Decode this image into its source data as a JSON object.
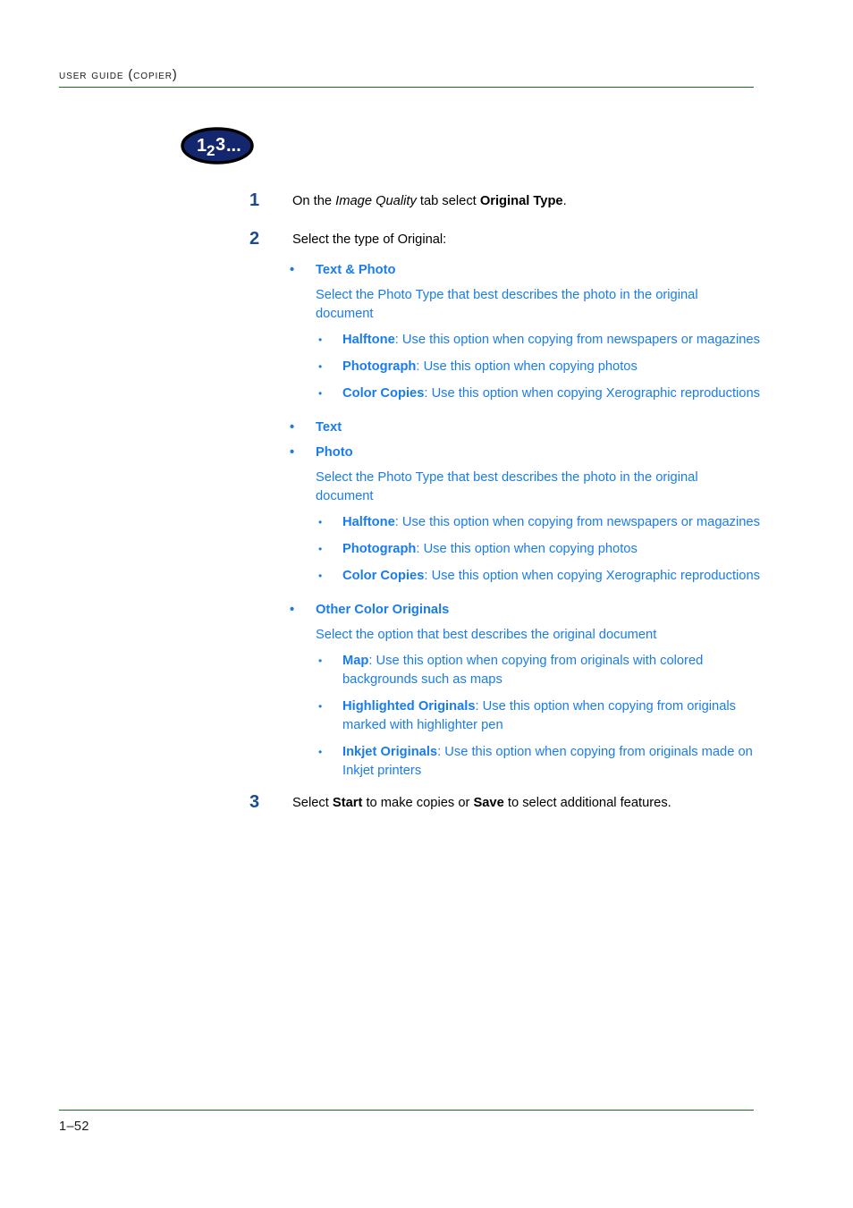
{
  "header": {
    "running_title": "User Guide (Copier)"
  },
  "badge": {
    "name": "numbered-steps-badge",
    "text": "123...",
    "fill_color": "#13266e",
    "stroke_color": "#000000",
    "text_color": "#ffffff",
    "parts": {
      "one": "1",
      "two": "2",
      "three": "3",
      "ellipsis": "..."
    }
  },
  "colors": {
    "rule_green": "#176b17",
    "step_number_blue": "#1b4a91",
    "option_blue": "#1a7ceb",
    "body_black": "#000000"
  },
  "steps": [
    {
      "number": "1",
      "text_before": "On the ",
      "italic": "Image Quality",
      "text_mid": " tab select ",
      "bold": "Original Type",
      "text_after": "."
    },
    {
      "number": "2",
      "text": "Select the type of Original:"
    },
    {
      "number": "3",
      "text_before": "Select ",
      "bold1": "Start",
      "text_mid": " to make copies or ",
      "bold2": "Save",
      "text_after": " to select additional features."
    }
  ],
  "options": [
    {
      "bullet": "•",
      "title": "Text & Photo",
      "description": "Select the Photo Type that best describes the photo in the original document",
      "subitems": [
        {
          "bullet": "•",
          "term": "Halftone",
          "desc": ": Use this option when copying from newspapers or magazines"
        },
        {
          "bullet": "•",
          "term": "Photograph",
          "desc": ": Use this option when copying photos"
        },
        {
          "bullet": "•",
          "term": "Color Copies",
          "desc": ": Use this option when copying Xerographic reproductions"
        }
      ]
    },
    {
      "bullet": "•",
      "title": "Text",
      "description": "",
      "subitems": []
    },
    {
      "bullet": "•",
      "title": "Photo",
      "description": "Select the Photo Type that best describes the photo in the original document",
      "subitems": [
        {
          "bullet": "•",
          "term": "Halftone",
          "desc": ": Use this option when copying from newspapers or magazines"
        },
        {
          "bullet": "•",
          "term": "Photograph",
          "desc": ": Use this option when copying photos"
        },
        {
          "bullet": "•",
          "term": "Color Copies",
          "desc": ": Use this option when copying Xerographic reproductions"
        }
      ]
    },
    {
      "bullet": "•",
      "title": "Other Color Originals",
      "description": "Select the option that best describes the original document",
      "subitems": [
        {
          "bullet": "•",
          "term": "Map",
          "desc": ": Use this option when copying from originals with colored backgrounds such as maps"
        },
        {
          "bullet": "•",
          "term": "Highlighted Originals",
          "desc": ": Use this option when copying from originals marked with highlighter pen"
        },
        {
          "bullet": "•",
          "term": "Inkjet Originals",
          "desc": ": Use this option when copying from originals made on Inkjet printers"
        }
      ]
    }
  ],
  "footer": {
    "page_number": "1–52"
  }
}
